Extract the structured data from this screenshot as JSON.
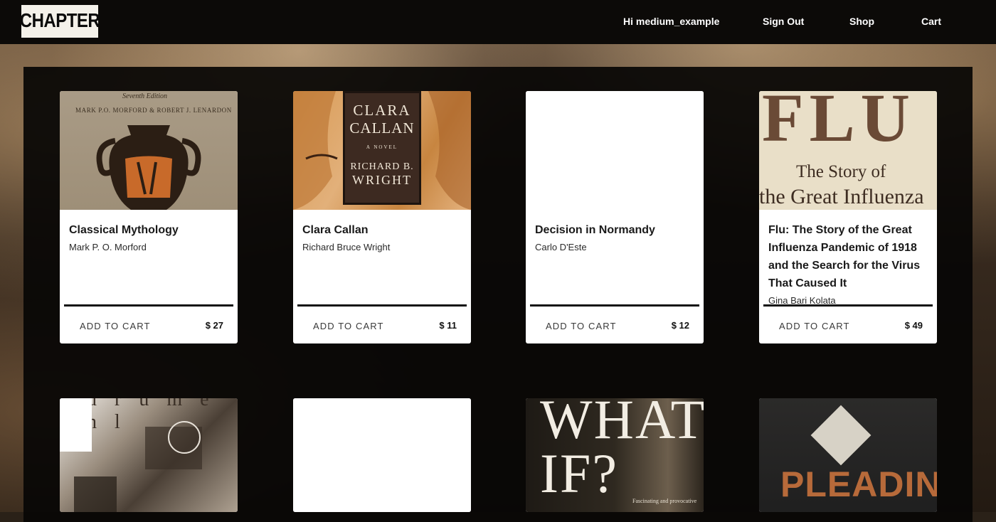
{
  "header": {
    "logo": "CHAPTER",
    "greeting": "Hi medium_example",
    "signout": "Sign Out",
    "shop": "Shop",
    "cart": "Cart"
  },
  "books": [
    {
      "title": "Classical Mythology",
      "author": "Mark P. O. Morford",
      "price": "$ 27",
      "cta": "ADD TO CART",
      "cover": {
        "line1": "Seventh Edition",
        "line2": "MARK P.O. MORFORD & ROBERT J. LENARDON"
      }
    },
    {
      "title": "Clara Callan",
      "author": "Richard Bruce Wright",
      "price": "$ 11",
      "cta": "ADD TO CART",
      "cover": {
        "title1": "CLARA",
        "title2": "CALLAN",
        "sub": "A NOVEL",
        "auth1": "RICHARD B.",
        "auth2": "WRIGHT"
      }
    },
    {
      "title": "Decision in Normandy",
      "author": "Carlo D'Este",
      "price": "$ 12",
      "cta": "ADD TO CART"
    },
    {
      "title": "Flu: The Story of the Great Influenza Pandemic of 1918 and the Search for the Virus That Caused It",
      "author": "Gina Bari Kolata",
      "price": "$ 49",
      "cta": "ADD TO CART",
      "cover": {
        "big": "FLU",
        "s1": "The Story of",
        "s2": "the Great Influenza"
      }
    }
  ],
  "second_row": [
    {
      "cover_text": "u r u m e n l"
    },
    {
      "cover_text": ""
    },
    {
      "cover_text": "WHAT IF?",
      "tagline": "Fascinating and provocative"
    },
    {
      "cover_text": "PLEADING"
    }
  ]
}
